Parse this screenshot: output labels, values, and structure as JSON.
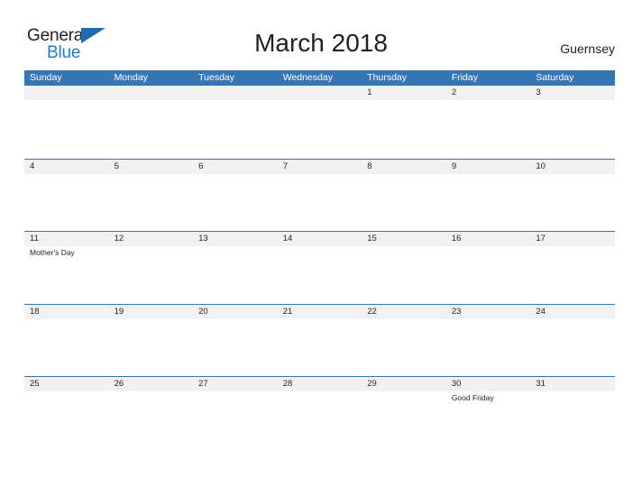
{
  "brand": {
    "name_part1": "General",
    "name_part2": "Blue",
    "flag_icon": "triangle-flag-icon"
  },
  "header": {
    "title": "March 2018",
    "region": "Guernsey"
  },
  "colors": {
    "header_blue": "#3776b5",
    "logo_blue": "#1f7ac4",
    "date_band_gray": "#f1f1f1",
    "text_dark": "#231f20"
  },
  "calendar": {
    "month": "March",
    "year": "2018",
    "weekday_headers": [
      "Sunday",
      "Monday",
      "Tuesday",
      "Wednesday",
      "Thursday",
      "Friday",
      "Saturday"
    ],
    "weeks": [
      {
        "dates": [
          "",
          "",
          "",
          "",
          "1",
          "2",
          "3"
        ],
        "events": [
          "",
          "",
          "",
          "",
          "",
          "",
          ""
        ]
      },
      {
        "dates": [
          "4",
          "5",
          "6",
          "7",
          "8",
          "9",
          "10"
        ],
        "events": [
          "",
          "",
          "",
          "",
          "",
          "",
          ""
        ]
      },
      {
        "dates": [
          "11",
          "12",
          "13",
          "14",
          "15",
          "16",
          "17"
        ],
        "events": [
          "Mother's Day",
          "",
          "",
          "",
          "",
          "",
          ""
        ]
      },
      {
        "dates": [
          "18",
          "19",
          "20",
          "21",
          "22",
          "23",
          "24"
        ],
        "events": [
          "",
          "",
          "",
          "",
          "",
          "",
          ""
        ]
      },
      {
        "dates": [
          "25",
          "26",
          "27",
          "28",
          "29",
          "30",
          "31"
        ],
        "events": [
          "",
          "",
          "",
          "",
          "",
          "Good Friday",
          ""
        ]
      }
    ]
  }
}
